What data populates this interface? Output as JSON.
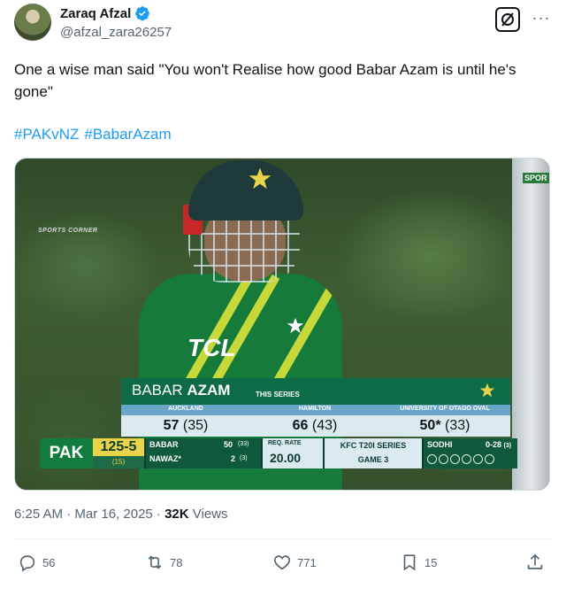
{
  "author": {
    "display_name": "Zaraq Afzal",
    "handle": "@afzal_zara26257",
    "verified": true,
    "verified_color": "#1d9bf0"
  },
  "header_actions": {
    "grok_icon": "grok-slash-icon",
    "more_label": "···"
  },
  "tweet": {
    "text": "One a wise man said \"You won't Realise how good Babar Azam is until he's gone\"",
    "hashtags": [
      "#PAKvNZ",
      "#BabarAzam"
    ],
    "hashtag_color": "#1d9bf0"
  },
  "media": {
    "watermark": "SPORTS CORNER",
    "pole_tag": "SPOR",
    "jersey_sponsor": "TCL",
    "lower_third": {
      "first_name": "BABAR ",
      "last_name": "AZAM",
      "label": "THIS SERIES",
      "venues": [
        {
          "name": "AUCKLAND",
          "score": "57",
          "balls": " (35)"
        },
        {
          "name": "HAMILTON",
          "score": "66",
          "balls": " (43)"
        },
        {
          "name": "UNIVERSITY OF OTAGO OVAL",
          "score": "50*",
          "balls": " (33)"
        }
      ]
    },
    "scorebug": {
      "team": "PAK",
      "score": "125-5",
      "overs": "(15)",
      "batters": [
        {
          "name": "BABAR",
          "runs": "50",
          "balls": "(33)"
        },
        {
          "name": "NAWAZ*",
          "runs": "2",
          "balls": "(3)"
        }
      ],
      "req_rate_label": "REQ. RATE",
      "req_rate": "20.00",
      "series_line1": "KFC T20I SERIES",
      "series_line2": "GAME 3",
      "bowler": "SODHI",
      "bowler_figures": "0-28",
      "bowler_overs": "(3)",
      "colors": {
        "primary": "#127c3e",
        "accent": "#e9d34a",
        "dark": "#0e3b2b"
      }
    }
  },
  "meta": {
    "time": "6:25 AM · Mar 16, 2025 · ",
    "views_count": "32K",
    "views_label": " Views"
  },
  "actions": {
    "reply": {
      "icon": "reply-icon",
      "count": "56"
    },
    "repost": {
      "icon": "repost-icon",
      "count": "78"
    },
    "like": {
      "icon": "heart-icon",
      "count": "771"
    },
    "bookmark": {
      "icon": "bookmark-icon",
      "count": "15"
    },
    "share": {
      "icon": "share-icon"
    }
  }
}
